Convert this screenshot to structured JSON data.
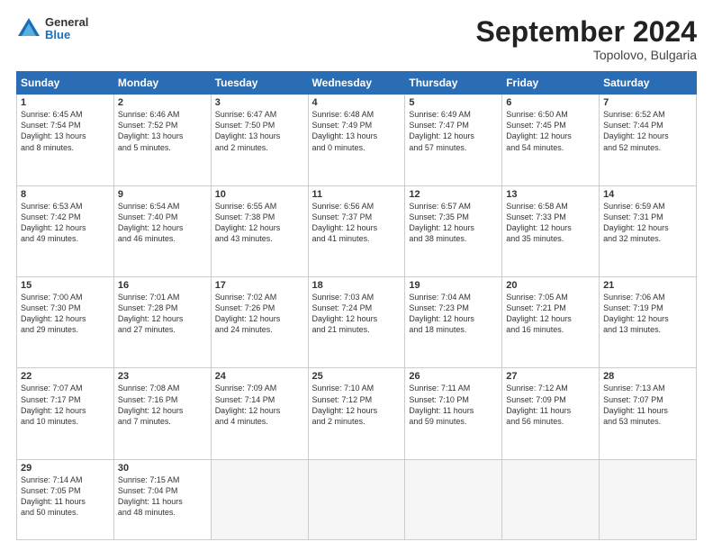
{
  "header": {
    "logo": {
      "general": "General",
      "blue": "Blue"
    },
    "title": "September 2024",
    "location": "Topolovo, Bulgaria"
  },
  "weekdays": [
    "Sunday",
    "Monday",
    "Tuesday",
    "Wednesday",
    "Thursday",
    "Friday",
    "Saturday"
  ],
  "weeks": [
    [
      {
        "day": "1",
        "info": "Sunrise: 6:45 AM\nSunset: 7:54 PM\nDaylight: 13 hours\nand 8 minutes."
      },
      {
        "day": "2",
        "info": "Sunrise: 6:46 AM\nSunset: 7:52 PM\nDaylight: 13 hours\nand 5 minutes."
      },
      {
        "day": "3",
        "info": "Sunrise: 6:47 AM\nSunset: 7:50 PM\nDaylight: 13 hours\nand 2 minutes."
      },
      {
        "day": "4",
        "info": "Sunrise: 6:48 AM\nSunset: 7:49 PM\nDaylight: 13 hours\nand 0 minutes."
      },
      {
        "day": "5",
        "info": "Sunrise: 6:49 AM\nSunset: 7:47 PM\nDaylight: 12 hours\nand 57 minutes."
      },
      {
        "day": "6",
        "info": "Sunrise: 6:50 AM\nSunset: 7:45 PM\nDaylight: 12 hours\nand 54 minutes."
      },
      {
        "day": "7",
        "info": "Sunrise: 6:52 AM\nSunset: 7:44 PM\nDaylight: 12 hours\nand 52 minutes."
      }
    ],
    [
      {
        "day": "8",
        "info": "Sunrise: 6:53 AM\nSunset: 7:42 PM\nDaylight: 12 hours\nand 49 minutes."
      },
      {
        "day": "9",
        "info": "Sunrise: 6:54 AM\nSunset: 7:40 PM\nDaylight: 12 hours\nand 46 minutes."
      },
      {
        "day": "10",
        "info": "Sunrise: 6:55 AM\nSunset: 7:38 PM\nDaylight: 12 hours\nand 43 minutes."
      },
      {
        "day": "11",
        "info": "Sunrise: 6:56 AM\nSunset: 7:37 PM\nDaylight: 12 hours\nand 41 minutes."
      },
      {
        "day": "12",
        "info": "Sunrise: 6:57 AM\nSunset: 7:35 PM\nDaylight: 12 hours\nand 38 minutes."
      },
      {
        "day": "13",
        "info": "Sunrise: 6:58 AM\nSunset: 7:33 PM\nDaylight: 12 hours\nand 35 minutes."
      },
      {
        "day": "14",
        "info": "Sunrise: 6:59 AM\nSunset: 7:31 PM\nDaylight: 12 hours\nand 32 minutes."
      }
    ],
    [
      {
        "day": "15",
        "info": "Sunrise: 7:00 AM\nSunset: 7:30 PM\nDaylight: 12 hours\nand 29 minutes."
      },
      {
        "day": "16",
        "info": "Sunrise: 7:01 AM\nSunset: 7:28 PM\nDaylight: 12 hours\nand 27 minutes."
      },
      {
        "day": "17",
        "info": "Sunrise: 7:02 AM\nSunset: 7:26 PM\nDaylight: 12 hours\nand 24 minutes."
      },
      {
        "day": "18",
        "info": "Sunrise: 7:03 AM\nSunset: 7:24 PM\nDaylight: 12 hours\nand 21 minutes."
      },
      {
        "day": "19",
        "info": "Sunrise: 7:04 AM\nSunset: 7:23 PM\nDaylight: 12 hours\nand 18 minutes."
      },
      {
        "day": "20",
        "info": "Sunrise: 7:05 AM\nSunset: 7:21 PM\nDaylight: 12 hours\nand 16 minutes."
      },
      {
        "day": "21",
        "info": "Sunrise: 7:06 AM\nSunset: 7:19 PM\nDaylight: 12 hours\nand 13 minutes."
      }
    ],
    [
      {
        "day": "22",
        "info": "Sunrise: 7:07 AM\nSunset: 7:17 PM\nDaylight: 12 hours\nand 10 minutes."
      },
      {
        "day": "23",
        "info": "Sunrise: 7:08 AM\nSunset: 7:16 PM\nDaylight: 12 hours\nand 7 minutes."
      },
      {
        "day": "24",
        "info": "Sunrise: 7:09 AM\nSunset: 7:14 PM\nDaylight: 12 hours\nand 4 minutes."
      },
      {
        "day": "25",
        "info": "Sunrise: 7:10 AM\nSunset: 7:12 PM\nDaylight: 12 hours\nand 2 minutes."
      },
      {
        "day": "26",
        "info": "Sunrise: 7:11 AM\nSunset: 7:10 PM\nDaylight: 11 hours\nand 59 minutes."
      },
      {
        "day": "27",
        "info": "Sunrise: 7:12 AM\nSunset: 7:09 PM\nDaylight: 11 hours\nand 56 minutes."
      },
      {
        "day": "28",
        "info": "Sunrise: 7:13 AM\nSunset: 7:07 PM\nDaylight: 11 hours\nand 53 minutes."
      }
    ],
    [
      {
        "day": "29",
        "info": "Sunrise: 7:14 AM\nSunset: 7:05 PM\nDaylight: 11 hours\nand 50 minutes."
      },
      {
        "day": "30",
        "info": "Sunrise: 7:15 AM\nSunset: 7:04 PM\nDaylight: 11 hours\nand 48 minutes."
      },
      {
        "day": "",
        "info": ""
      },
      {
        "day": "",
        "info": ""
      },
      {
        "day": "",
        "info": ""
      },
      {
        "day": "",
        "info": ""
      },
      {
        "day": "",
        "info": ""
      }
    ]
  ]
}
